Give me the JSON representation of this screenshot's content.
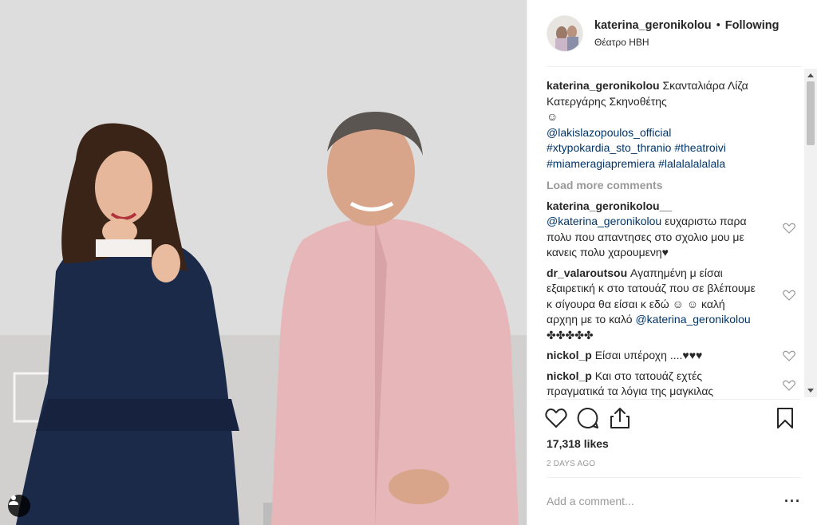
{
  "post": {
    "username": "katerina_geronikolou",
    "separator": "•",
    "follow_label": "Following",
    "location": "Θέατρο ΗΒΗ",
    "caption": {
      "username": "katerina_geronikolou",
      "text": "Σκανταλιάρα Λίζα Κατεργάρης Σκηνοθέτης",
      "emoji": "☺",
      "mention": "@lakislazopoulos_official",
      "tags": [
        "#xtypokardia_sto_thranio",
        "#theatroivi",
        "#miameragiapremiera",
        "#lalalalalalala"
      ]
    },
    "load_more": "Load more comments",
    "comments": [
      {
        "username": "katerina_geronikolou__",
        "mention": "@katerina_geronikolou",
        "text": "ευχαριστω παρα πολυ που απαντησες στο σχολιο μου με κανεις πολυ χαρουμενη♥"
      },
      {
        "username": "dr_valaroutsou",
        "text": "Αγαπημένη μ είσαι εξαιρετική κ στο τατουάζ που σε βλέπουμε κ σίγουρα θα είσαι κ εδώ ☺ ☺ καλή αρχηη με το καλό",
        "mention": "@katerina_geronikolou",
        "suffix": "✤✤✤✤✤"
      },
      {
        "username": "nickol_p",
        "text": "Είσαι υπέροχη ....♥♥♥"
      },
      {
        "username": "nickol_p",
        "text": "Και στο τατουάζ εχτές πραγματικά τα λόγια της μαγκιλας"
      }
    ],
    "likes": "17,318 likes",
    "time": "2 DAYS AGO",
    "add_comment_placeholder": "Add a comment...",
    "more_label": "···"
  },
  "icons": {
    "like": "heart-icon",
    "comment": "comment-bubble-icon",
    "share": "share-icon",
    "save": "bookmark-icon",
    "user_tag": "user-tag-icon"
  }
}
